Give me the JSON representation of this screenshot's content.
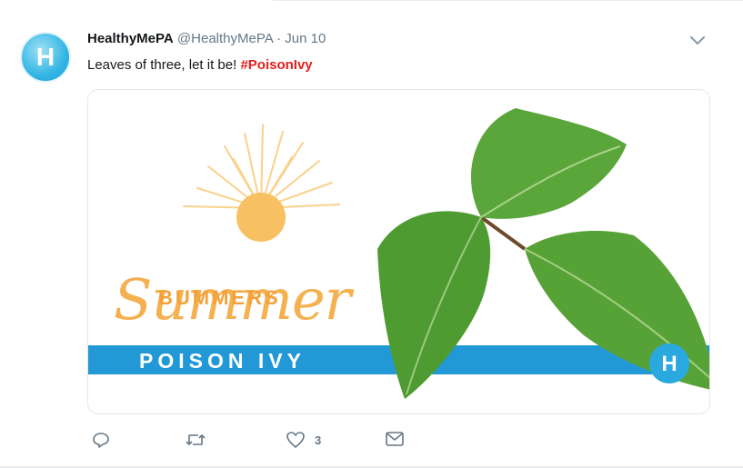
{
  "tweet": {
    "author_name": "HealthyMePA",
    "handle": "@HealthyMePA",
    "separator": "·",
    "date": "Jun 10",
    "text": "Leaves of three, let it be!",
    "hashtag": "#PoisonIvy",
    "avatar_letter": "H",
    "avatar_color": "#33b6e4"
  },
  "card": {
    "script_word": "Summer",
    "subtitle": "BUMMERS",
    "banner_label": "POISON IVY",
    "logo_letter": "H",
    "banner_color": "#2299d6",
    "sun_color": "#f7c163",
    "leaf_color": "#4e9b31"
  },
  "actions": {
    "reply_icon": "reply-icon",
    "retweet_icon": "retweet-icon",
    "like_icon": "heart-icon",
    "like_count": "3",
    "message_icon": "envelope-icon"
  },
  "colors": {
    "hashtag": "#e0201b",
    "secondary_text": "#657786",
    "divider": "#e6ecf0"
  }
}
